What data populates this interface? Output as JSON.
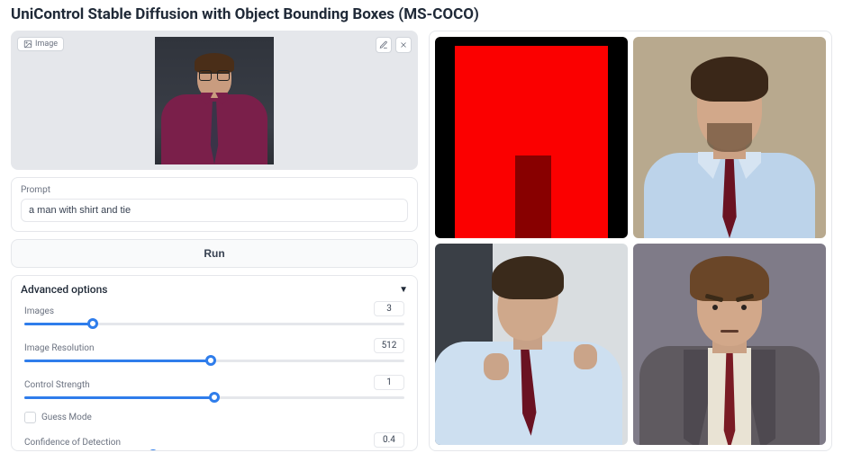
{
  "title": "UniControl Stable Diffusion with Object Bounding Boxes (MS-COCO)",
  "image_panel": {
    "badge": "Image",
    "alt": "Input image: man in purple shirt and tie"
  },
  "prompt": {
    "label": "Prompt",
    "value": "a man with shirt and tie"
  },
  "run_label": "Run",
  "advanced": {
    "title": "Advanced options",
    "images": {
      "label": "Images",
      "value": "3",
      "percent": 18
    },
    "resolution": {
      "label": "Image Resolution",
      "value": "512",
      "percent": 49
    },
    "strength": {
      "label": "Control Strength",
      "value": "1",
      "percent": 50
    },
    "guess": {
      "label": "Guess Mode",
      "checked": false
    },
    "confidence": {
      "label": "Confidence of Detection",
      "value": "0.4",
      "percent": 34
    }
  },
  "gallery": {
    "items": [
      {
        "alt": "Bounding box visualization on black background with red region"
      },
      {
        "alt": "Generated photo: man in light blue shirt with dark red tie"
      },
      {
        "alt": "Generated photo: man adjusting collar, blue shirt, red tie"
      },
      {
        "alt": "Generated illustration: man in grey suit with red tie"
      }
    ]
  }
}
